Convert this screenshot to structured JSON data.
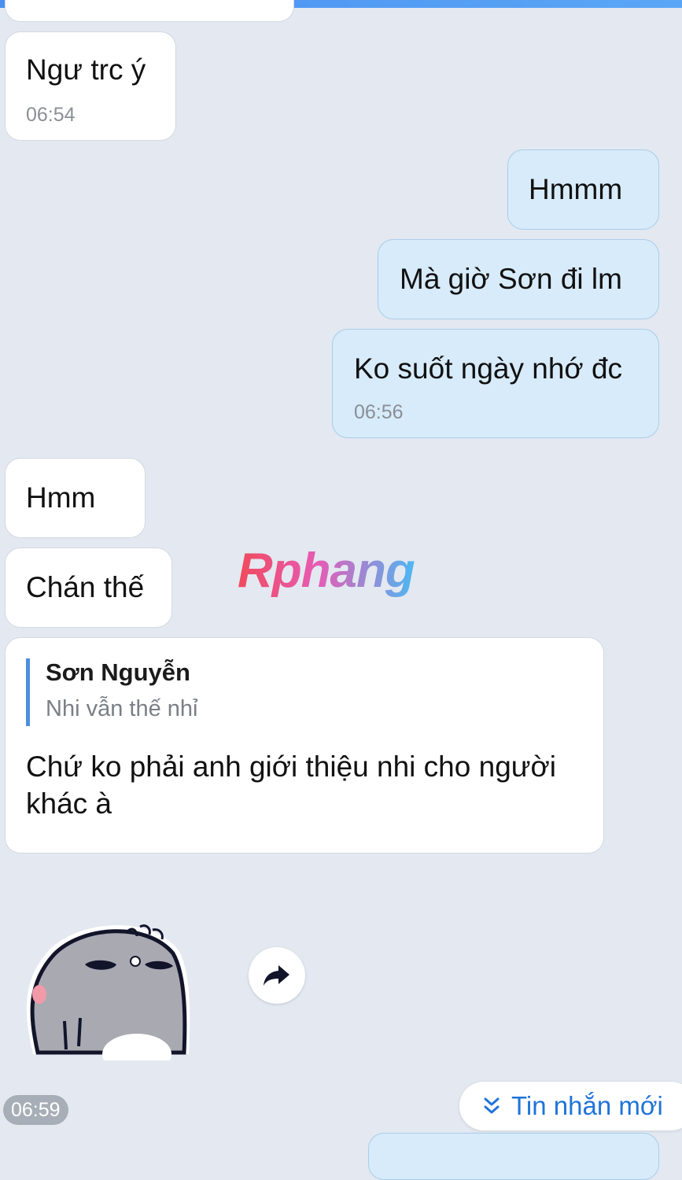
{
  "messages": [
    {
      "text": "Ngư trc ý",
      "time": "06:54"
    },
    {
      "text": "Hmmm"
    },
    {
      "text": "Mà giờ Sơn đi lm"
    },
    {
      "text": "Ko suốt ngày nhớ đc",
      "time": "06:56"
    },
    {
      "text": "Hmm"
    },
    {
      "text": "Chán thế"
    }
  ],
  "reply": {
    "quoted_name": "Sơn Nguyễn",
    "quoted_text": "Nhi vẫn thế nhỉ",
    "text": "Chứ ko phải anh giới thiệu nhi cho người khác à"
  },
  "watermark": "Rphang",
  "sticker_time": "06:59",
  "new_messages_button": {
    "label": "Tin nhắn mới",
    "icon": "double-chevron-down-icon"
  },
  "forward_icon": "forward-arrow-icon",
  "colors": {
    "incoming": "#ffffff",
    "outgoing": "#d7ebfa",
    "accent": "#1f74d8",
    "background": "#e3e8f1"
  }
}
